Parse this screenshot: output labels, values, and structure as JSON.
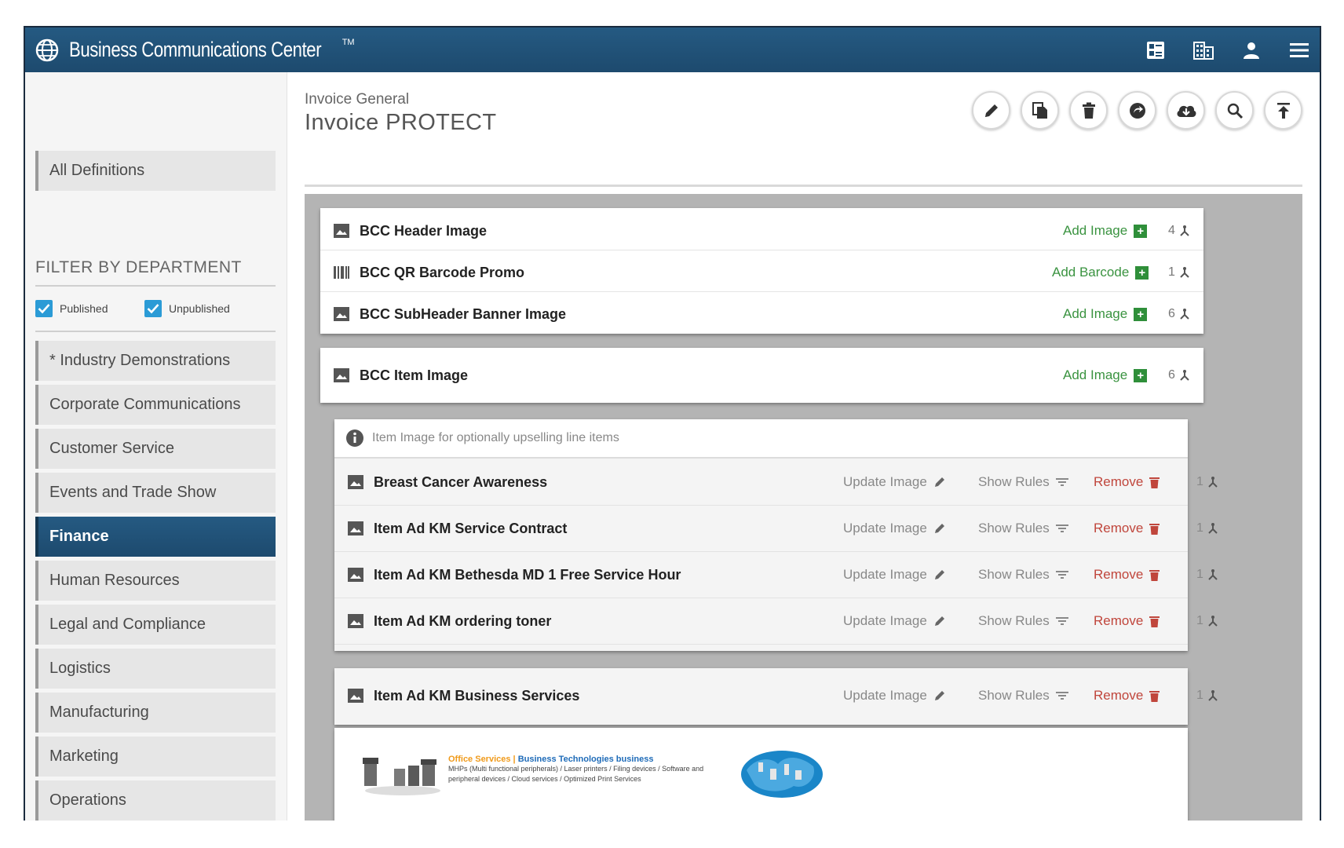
{
  "app": {
    "title": "Business Communications Center",
    "trademark": "TM",
    "header_icons": [
      "dashboard-icon",
      "building-icon",
      "user-icon",
      "menu-icon"
    ]
  },
  "sidebar": {
    "all_definitions": "All Definitions",
    "filter_heading": "FILTER BY DEPARTMENT",
    "published_label": "Published",
    "unpublished_label": "Unpublished",
    "published_checked": true,
    "unpublished_checked": true,
    "departments": [
      "* Industry Demonstrations",
      "Corporate Communications",
      "Customer Service",
      "Events and Trade Show",
      "Finance",
      "Human Resources",
      "Legal and Compliance",
      "Logistics",
      "Manufacturing",
      "Marketing",
      "Operations"
    ],
    "active_department": "Finance"
  },
  "main": {
    "breadcrumb": "Invoice General",
    "title": "Invoice PROTECT",
    "actions": [
      "edit-icon",
      "copy-icon",
      "delete-icon",
      "publish-icon",
      "cloud-download-icon",
      "search-icon",
      "upload-icon"
    ],
    "header_cards": [
      {
        "label": "BCC Header Image",
        "icon": "image-icon",
        "add_label": "Add Image",
        "count": "4"
      },
      {
        "label": "BCC QR Barcode Promo",
        "icon": "barcode-icon",
        "add_label": "Add Barcode",
        "count": "1"
      },
      {
        "label": "BCC SubHeader Banner Image",
        "icon": "image-icon",
        "add_label": "Add Image",
        "count": "6"
      }
    ],
    "item_card": {
      "label": "BCC Item Image",
      "icon": "image-icon",
      "add_label": "Add Image",
      "count": "6"
    },
    "item_info": "Item Image for optionally upselling line items",
    "item_rows": [
      {
        "label": "Breast Cancer Awareness",
        "update": "Update Image",
        "rules": "Show Rules",
        "remove": "Remove",
        "count": "1"
      },
      {
        "label": "Item Ad KM Service Contract",
        "update": "Update Image",
        "rules": "Show Rules",
        "remove": "Remove",
        "count": "1"
      },
      {
        "label": "Item Ad KM Bethesda MD 1 Free Service Hour",
        "update": "Update Image",
        "rules": "Show Rules",
        "remove": "Remove",
        "count": "1"
      },
      {
        "label": "Item Ad KM ordering toner",
        "update": "Update Image",
        "rules": "Show Rules",
        "remove": "Remove",
        "count": "1"
      }
    ],
    "expanded_row": {
      "label": "Item Ad KM Business Services",
      "update": "Update Image",
      "rules": "Show Rules",
      "remove": "Remove",
      "count": "1"
    },
    "banner": {
      "heading_part1": "Office Services |",
      "heading_part2": "Business Technologies business",
      "line2": "MHPs (Multi functional peripherals) / Laser printers / Filing devices / Software and",
      "line3": "peripheral devices / Cloud services / Optimized Print Services"
    }
  },
  "colors": {
    "header_blue": "#1d4a6e",
    "add_green": "#3a9340",
    "remove_red": "#c0463c",
    "check_blue": "#2b9bd6"
  }
}
